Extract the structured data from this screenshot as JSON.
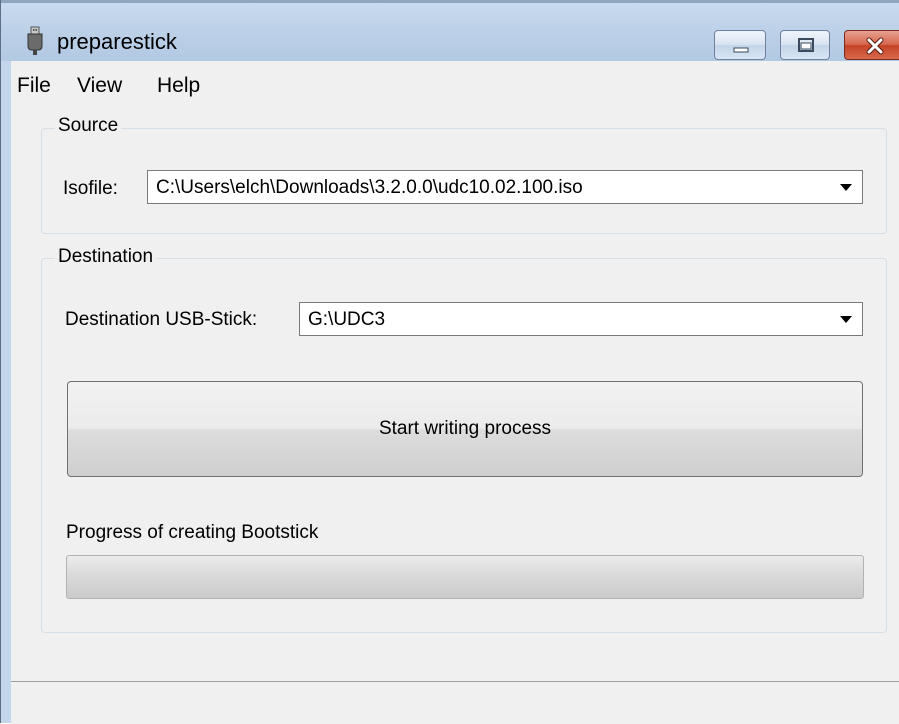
{
  "window": {
    "title": "preparestick",
    "app_icon": "usb-plug-icon",
    "controls": {
      "minimize": "minimize-icon",
      "maximize": "maximize-icon",
      "close": "close-icon"
    }
  },
  "menu": {
    "file": "File",
    "view": "View",
    "help": "Help"
  },
  "source": {
    "group_label": "Source",
    "isofile_label": "Isofile:",
    "isofile_value": "C:\\Users\\elch\\Downloads\\3.2.0.0\\udc10.02.100.iso"
  },
  "destination": {
    "group_label": "Destination",
    "usb_label": "Destination USB-Stick:",
    "usb_value": "G:\\UDC3",
    "start_button": "Start writing process",
    "progress_label": "Progress of creating Bootstick",
    "progress": 0
  },
  "colors": {
    "titlebar": "#bdd1e8",
    "close_button": "#c44327",
    "progress_fill": "#37c83a"
  }
}
